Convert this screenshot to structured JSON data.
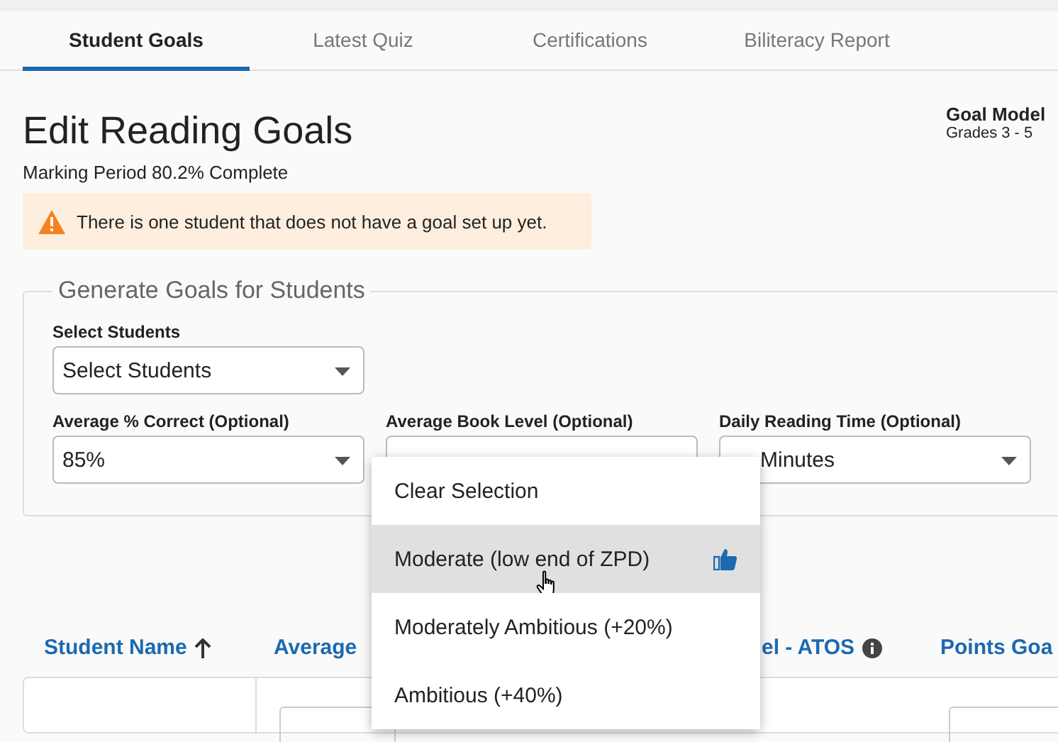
{
  "tabs": [
    {
      "label": "Student Goals",
      "selected": true
    },
    {
      "label": "Latest Quiz",
      "selected": false
    },
    {
      "label": "Certifications",
      "selected": false
    },
    {
      "label": "Biliteracy Report",
      "selected": false
    }
  ],
  "heading": {
    "title": "Edit Reading Goals",
    "progress": "Marking Period 80.2% Complete"
  },
  "goal_model": {
    "title": "Goal Model",
    "grades": "Grades 3 - 5"
  },
  "alert": {
    "text": "There is one student that does not have a goal set up yet."
  },
  "generate": {
    "legend": "Generate Goals for Students",
    "fields": [
      {
        "label": "Select Students",
        "value": "Select Students"
      },
      {
        "label": "Average % Correct (Optional)",
        "value": "85%"
      },
      {
        "label": "Average Book Level (Optional)"
      },
      {
        "label": "Daily Reading Time (Optional)",
        "value": "Minutes"
      }
    ]
  },
  "menu": {
    "options": [
      {
        "label": "Clear Selection",
        "highlighted": false,
        "recommended": false
      },
      {
        "label": "Moderate (low end of ZPD)",
        "highlighted": true,
        "recommended": true
      },
      {
        "label": "Moderately Ambitious (+20%)",
        "highlighted": false,
        "recommended": false
      },
      {
        "label": "Ambitious (+40%)",
        "highlighted": false,
        "recommended": false
      }
    ]
  },
  "table": {
    "columns": [
      {
        "label": "Student Name",
        "sorted_ascending": true,
        "info": false
      },
      {
        "label": "Average",
        "sorted_ascending": false,
        "info": false
      },
      {
        "label": "el - ATOS",
        "sorted_ascending": false,
        "info": true
      },
      {
        "label": "Points Goa",
        "sorted_ascending": false,
        "info": false
      }
    ]
  }
}
